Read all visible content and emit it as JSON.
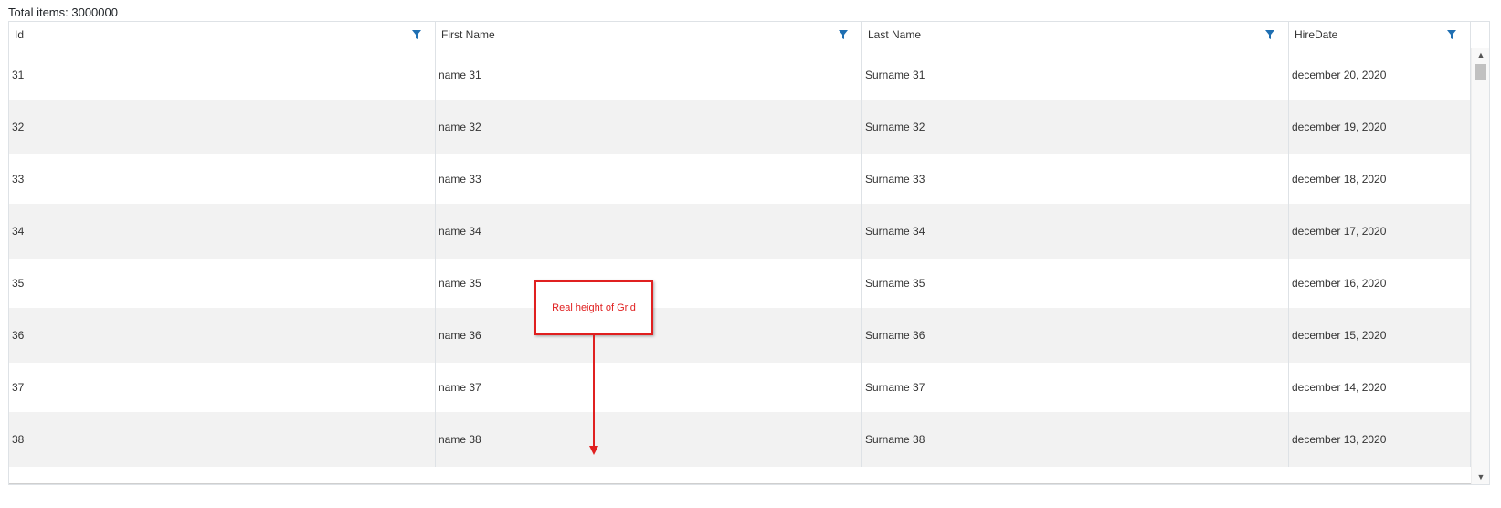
{
  "summary": {
    "total_items": "Total items: 3000000"
  },
  "columns": [
    {
      "label": "Id",
      "filter_icon": "filter-icon"
    },
    {
      "label": "First Name",
      "filter_icon": "filter-icon"
    },
    {
      "label": "Last Name",
      "filter_icon": "filter-icon"
    },
    {
      "label": "HireDate",
      "filter_icon": "filter-icon"
    }
  ],
  "rows": [
    {
      "id": "31",
      "first": "name 31",
      "last": "Surname 31",
      "hire": "december 20, 2020"
    },
    {
      "id": "32",
      "first": "name 32",
      "last": "Surname 32",
      "hire": "december 19, 2020"
    },
    {
      "id": "33",
      "first": "name 33",
      "last": "Surname 33",
      "hire": "december 18, 2020"
    },
    {
      "id": "34",
      "first": "name 34",
      "last": "Surname 34",
      "hire": "december 17, 2020"
    },
    {
      "id": "35",
      "first": "name 35",
      "last": "Surname 35",
      "hire": "december 16, 2020"
    },
    {
      "id": "36",
      "first": "name 36",
      "last": "Surname 36",
      "hire": "december 15, 2020"
    },
    {
      "id": "37",
      "first": "name 37",
      "last": "Surname 37",
      "hire": "december 14, 2020"
    },
    {
      "id": "38",
      "first": "name 38",
      "last": "Surname 38",
      "hire": "december 13, 2020"
    }
  ],
  "annotation": {
    "text": "Real height of Grid"
  },
  "colors": {
    "filter": "#1f6fb2",
    "annotation": "#e02020",
    "row_alt": "#f2f2f2"
  },
  "scrollbar": {
    "up_glyph": "▲",
    "down_glyph": "▼"
  }
}
